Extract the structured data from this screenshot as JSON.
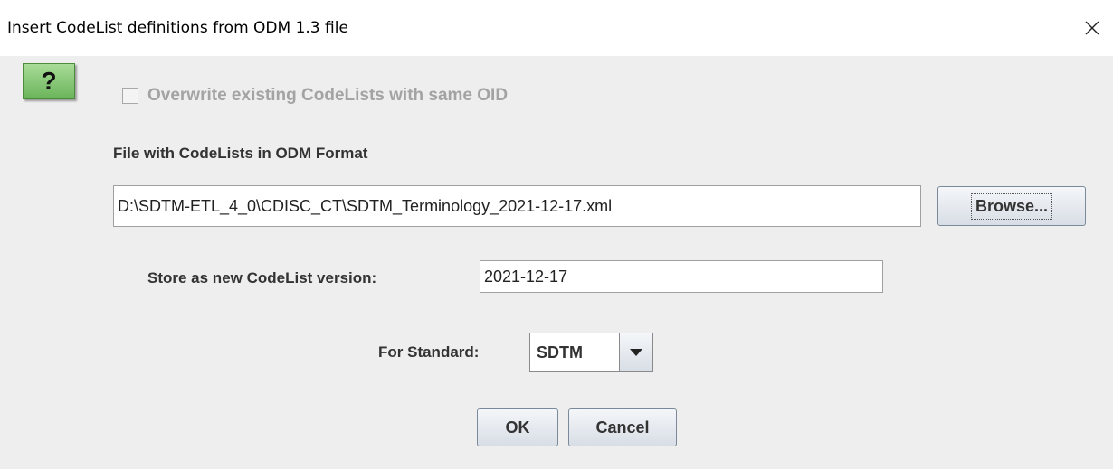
{
  "window": {
    "title": "Insert CodeList definitions from ODM 1.3 file",
    "close_icon": "close-icon"
  },
  "help": {
    "icon": "help-question-icon",
    "glyph": "?"
  },
  "overwrite": {
    "label": "Overwrite existing CodeLists with same OID",
    "checked": false,
    "enabled": false
  },
  "file": {
    "label": "File with CodeLists in ODM Format",
    "value": "D:\\SDTM-ETL_4_0\\CDISC_CT\\SDTM_Terminology_2021-12-17.xml",
    "browse_label": "Browse..."
  },
  "version": {
    "label": "Store as new CodeList version:",
    "value": "2021-12-17"
  },
  "standard": {
    "label": "For Standard:",
    "selected": "SDTM",
    "arrow_icon": "triangle-down-icon"
  },
  "actions": {
    "ok_label": "OK",
    "cancel_label": "Cancel"
  },
  "colors": {
    "dialog_bg": "#eeeeee",
    "help_green": "#7ec46c",
    "disabled_text": "#a3a3a3"
  }
}
